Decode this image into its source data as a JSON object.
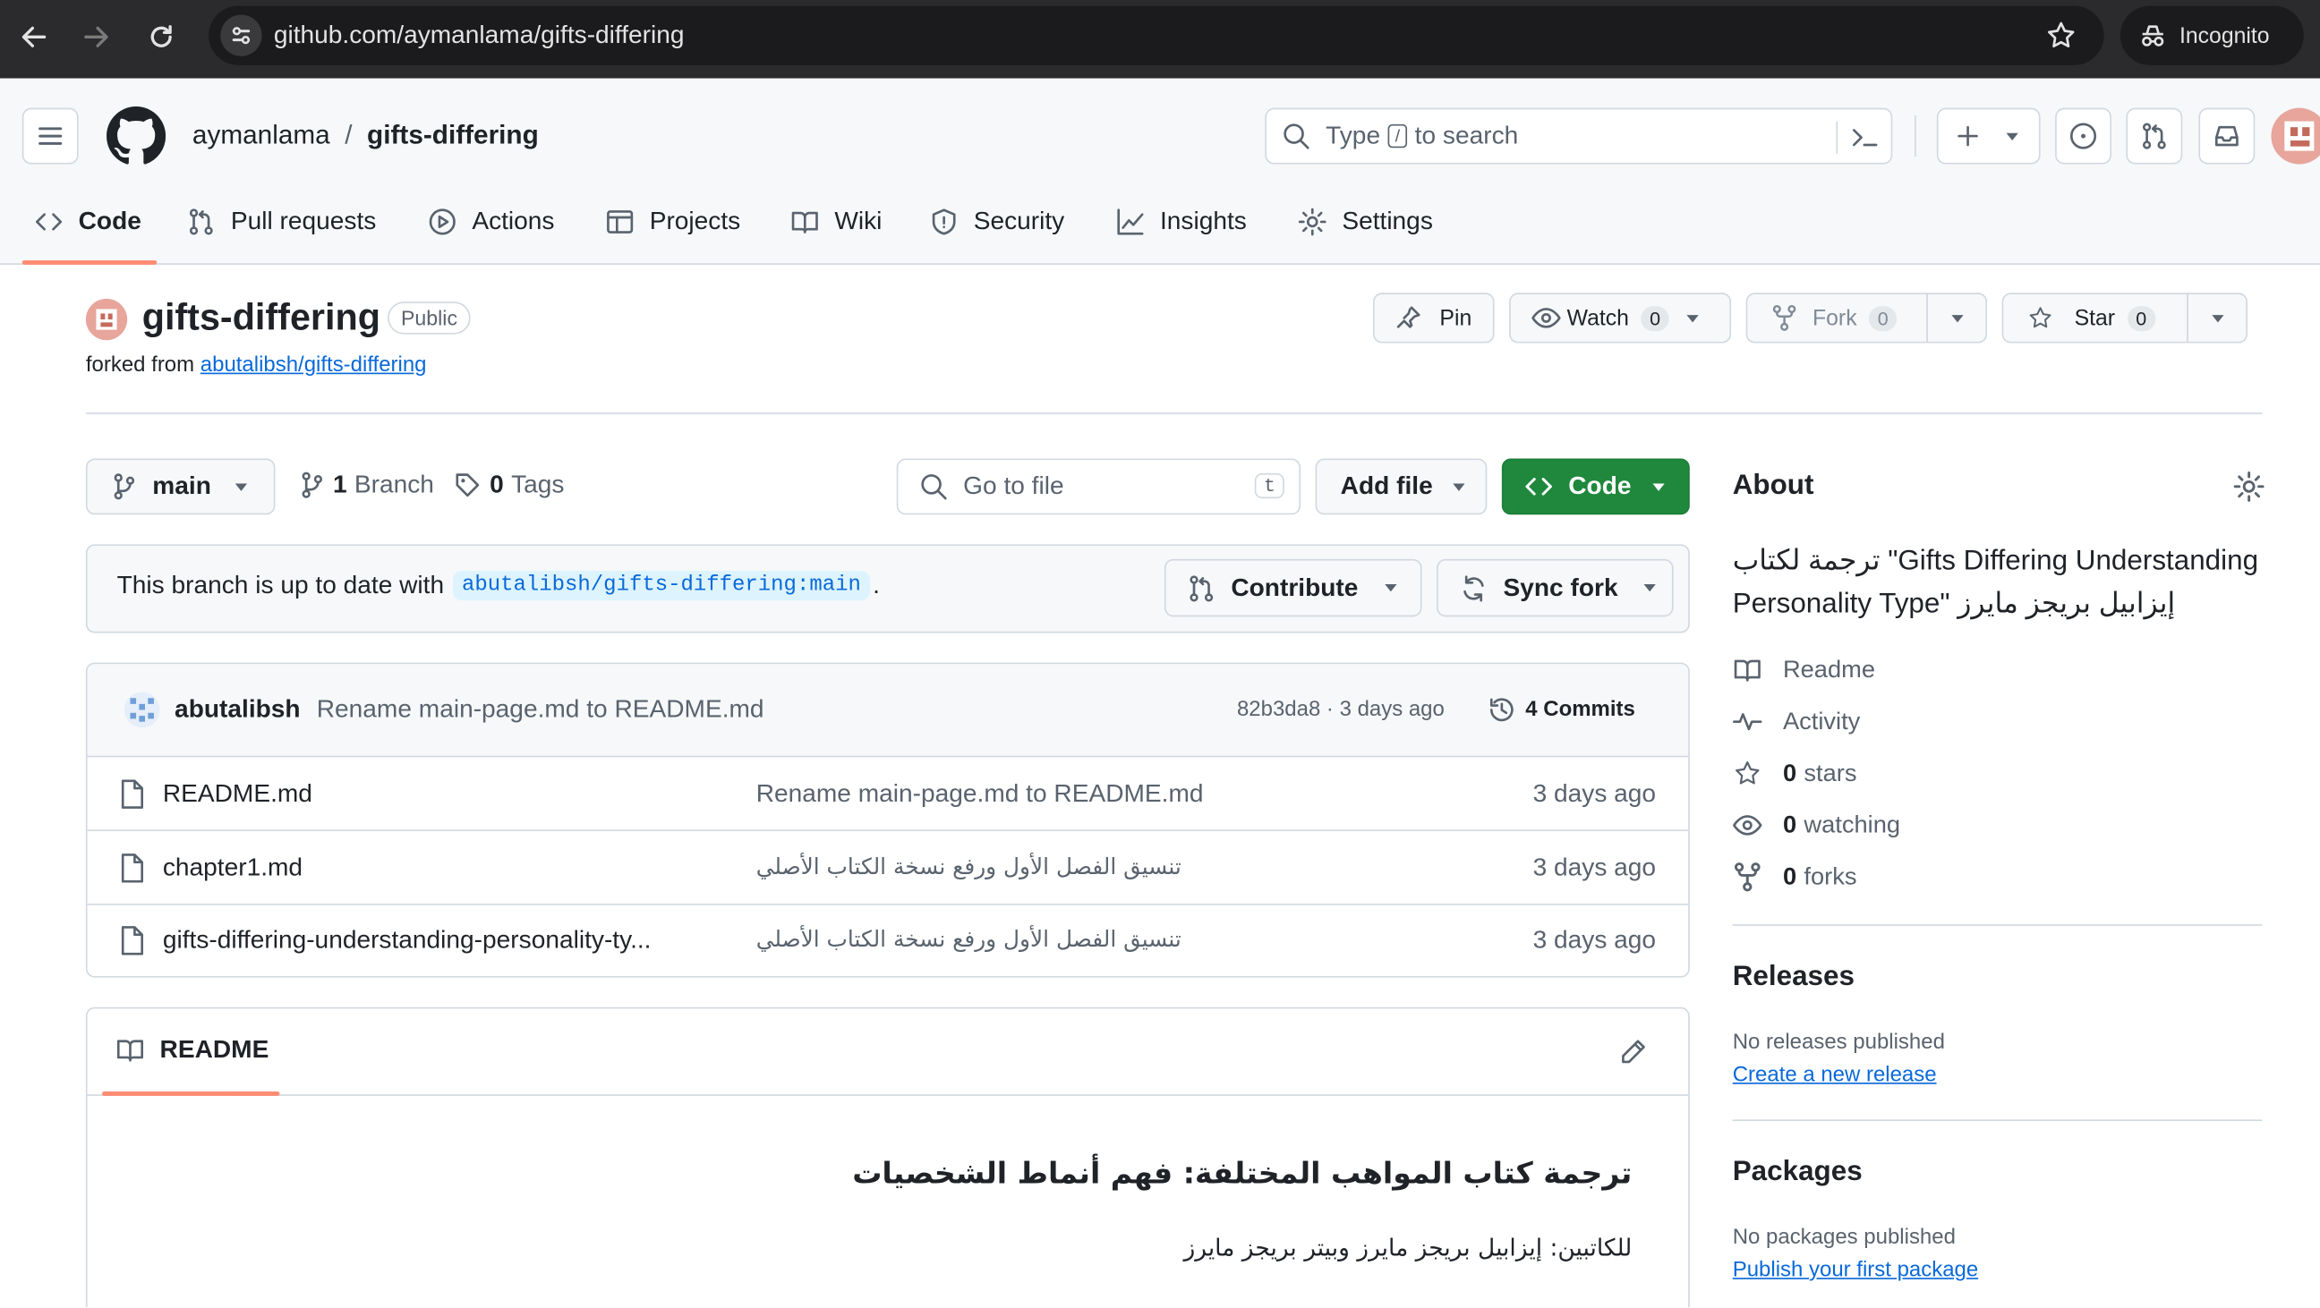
{
  "browser": {
    "url": "github.com/aymanlama/gifts-differing",
    "incognito_label": "Incognito"
  },
  "header": {
    "owner": "aymanlama",
    "separator": "/",
    "repo": "gifts-differing",
    "search_pre": "Type",
    "search_key": "/",
    "search_post": "to search"
  },
  "tabs": [
    "Code",
    "Pull requests",
    "Actions",
    "Projects",
    "Wiki",
    "Security",
    "Insights",
    "Settings"
  ],
  "repo": {
    "name": "gifts-differing",
    "visibility": "Public",
    "forked_prefix": "forked from",
    "forked_from": "abutalibsh/gifts-differing",
    "pin_label": "Pin",
    "watch_label": "Watch",
    "watch_count": "0",
    "fork_label": "Fork",
    "fork_count": "0",
    "star_label": "Star",
    "star_count": "0"
  },
  "toolbar": {
    "branch": "main",
    "branch_count": "1",
    "branch_word": "Branch",
    "tag_count": "0",
    "tag_word": "Tags",
    "goto_placeholder": "Go to file",
    "goto_key": "t",
    "add_file": "Add file",
    "code": "Code"
  },
  "sync": {
    "text": "This branch is up to date with",
    "ref": "abutalibsh/gifts-differing:main",
    "period": ".",
    "contribute": "Contribute",
    "sync_fork": "Sync fork"
  },
  "commit": {
    "author": "abutalibsh",
    "message": "Rename main-page.md to README.md",
    "meta": "82b3da8 · 3 days ago",
    "commits": "4 Commits"
  },
  "files": [
    {
      "name": "README.md",
      "message": "Rename main-page.md to README.md",
      "date": "3 days ago"
    },
    {
      "name": "chapter1.md",
      "message": "تنسيق الفصل الأول ورفع نسخة الكتاب الأصلي",
      "date": "3 days ago"
    },
    {
      "name": "gifts-differing-understanding-personality-ty...",
      "message": "تنسيق الفصل الأول ورفع نسخة الكتاب الأصلي",
      "date": "3 days ago"
    }
  ],
  "readme": {
    "tab": "README",
    "heading": "ترجمة كتاب المواهب المختلفة: فهم أنماط الشخصيات",
    "authors": "للكاتبين: إيزابيل بريجز مايرز وبيتر بريجز مايرز"
  },
  "about": {
    "title": "About",
    "description": "ترجمة لكتاب \"Gifts Differing Understanding Personality Type\" إيزابيل بريجز مايرز",
    "readme": "Readme",
    "activity": "Activity",
    "stars_n": "0",
    "stars": "stars",
    "watching_n": "0",
    "watching": "watching",
    "forks_n": "0",
    "forks": "forks"
  },
  "releases": {
    "title": "Releases",
    "none": "No releases published",
    "create": "Create a new release"
  },
  "packages": {
    "title": "Packages",
    "none": "No packages published",
    "publish": "Publish your first package"
  },
  "colors": {
    "accent": "#fd8c73",
    "green": "#1f883d",
    "link": "#0969da",
    "chrome_bg": "#2b2b2e"
  }
}
